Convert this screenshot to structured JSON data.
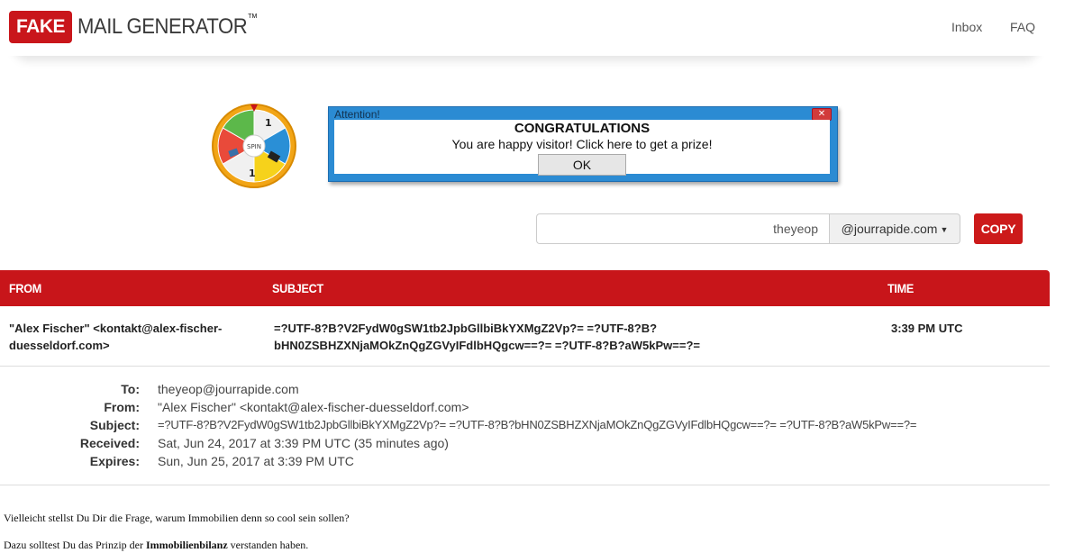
{
  "header": {
    "logo_fake": "FAKE",
    "logo_rest": "MAIL GENERATOR",
    "logo_tm": "™",
    "nav": {
      "inbox": "Inbox",
      "faq": "FAQ"
    }
  },
  "ad": {
    "wheel_center": "SPIN",
    "popup_title": "Attention!",
    "close_glyph": "✕",
    "heading": "CONGRATULATIONS",
    "message": "You are happy visitor!  Click here to get a prize!",
    "ok_label": "OK"
  },
  "address": {
    "username": "theyeop",
    "domain": "@jourrapide.com",
    "copy_label": "COPY"
  },
  "table": {
    "headers": {
      "from": "FROM",
      "subject": "SUBJECT",
      "time": "TIME"
    },
    "row": {
      "from": "\"Alex Fischer\" <kontakt@alex-fischer-duesseldorf.com>",
      "subject": "=?UTF-8?B?V2FydW0gSW1tb2JpbGllbiBkYXMgZ2Vp?= =?UTF-8?B?bHN0ZSBHZXNjaMOkZnQgZGVyIFdlbHQgcw==?= =?UTF-8?B?aW5kPw==?=",
      "time": "3:39 PM UTC"
    }
  },
  "details": {
    "to_label": "To:",
    "to": "theyeop@jourrapide.com",
    "from_label": "From:",
    "from": "\"Alex Fischer\" <kontakt@alex-fischer-duesseldorf.com>",
    "subject_label": "Subject:",
    "subject": "=?UTF-8?B?V2FydW0gSW1tb2JpbGllbiBkYXMgZ2Vp?= =?UTF-8?B?bHN0ZSBHZXNjaMOkZnQgZGVyIFdlbHQgcw==?= =?UTF-8?B?aW5kPw==?=",
    "received_label": "Received:",
    "received": "Sat, Jun 24, 2017 at 3:39 PM UTC (35 minutes ago)",
    "expires_label": "Expires:",
    "expires": "Sun, Jun 25, 2017 at 3:39 PM UTC"
  },
  "body": {
    "p1": "Vielleicht stellst Du Dir die Frage, warum Immobilien denn so cool sein sollen?",
    "p2_before": "Dazu solltest Du das Prinzip der ",
    "p2_bold": "Immobilienbilanz",
    "p2_after": " verstanden haben."
  },
  "colors": {
    "brand_red": "#c8151a",
    "popup_blue": "#2b8bd3"
  }
}
